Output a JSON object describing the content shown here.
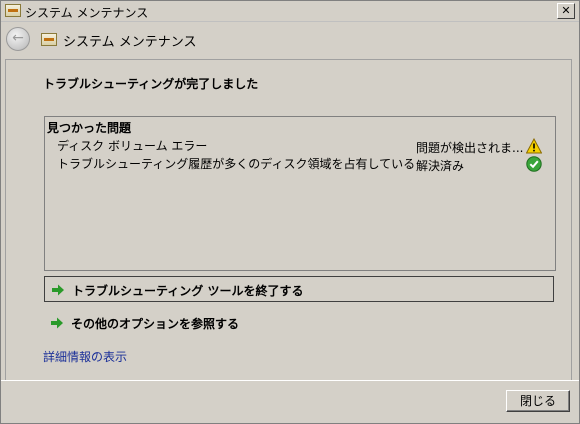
{
  "window": {
    "title": "システム メンテナンス",
    "close_glyph": "✕"
  },
  "nav": {
    "back_glyph": "←",
    "title": "システム メンテナンス"
  },
  "main": {
    "heading": "トラブルシューティングが完了しました",
    "problems": {
      "header": "見つかった問題",
      "items": [
        {
          "name": "ディスク ボリューム エラー",
          "status": "問題が検出されま...",
          "icon": "warning-icon"
        },
        {
          "name": "トラブルシューティング履歴が多くのディスク領域を占有している",
          "status": "解決済み",
          "icon": "check-icon"
        }
      ]
    },
    "actions": [
      {
        "label": "トラブルシューティング ツールを終了する",
        "icon": "green-arrow-icon"
      },
      {
        "label": "その他のオプションを参照する",
        "icon": "green-arrow-icon"
      }
    ],
    "details_link": "詳細情報の表示"
  },
  "footer": {
    "close_label": "閉じる"
  },
  "colors": {
    "window_bg": "#d4d0c8",
    "link": "#1a2f99",
    "arrow_green": "#2a9a2a",
    "warning_yellow": "#f5d000",
    "check_green": "#3aa53a"
  }
}
